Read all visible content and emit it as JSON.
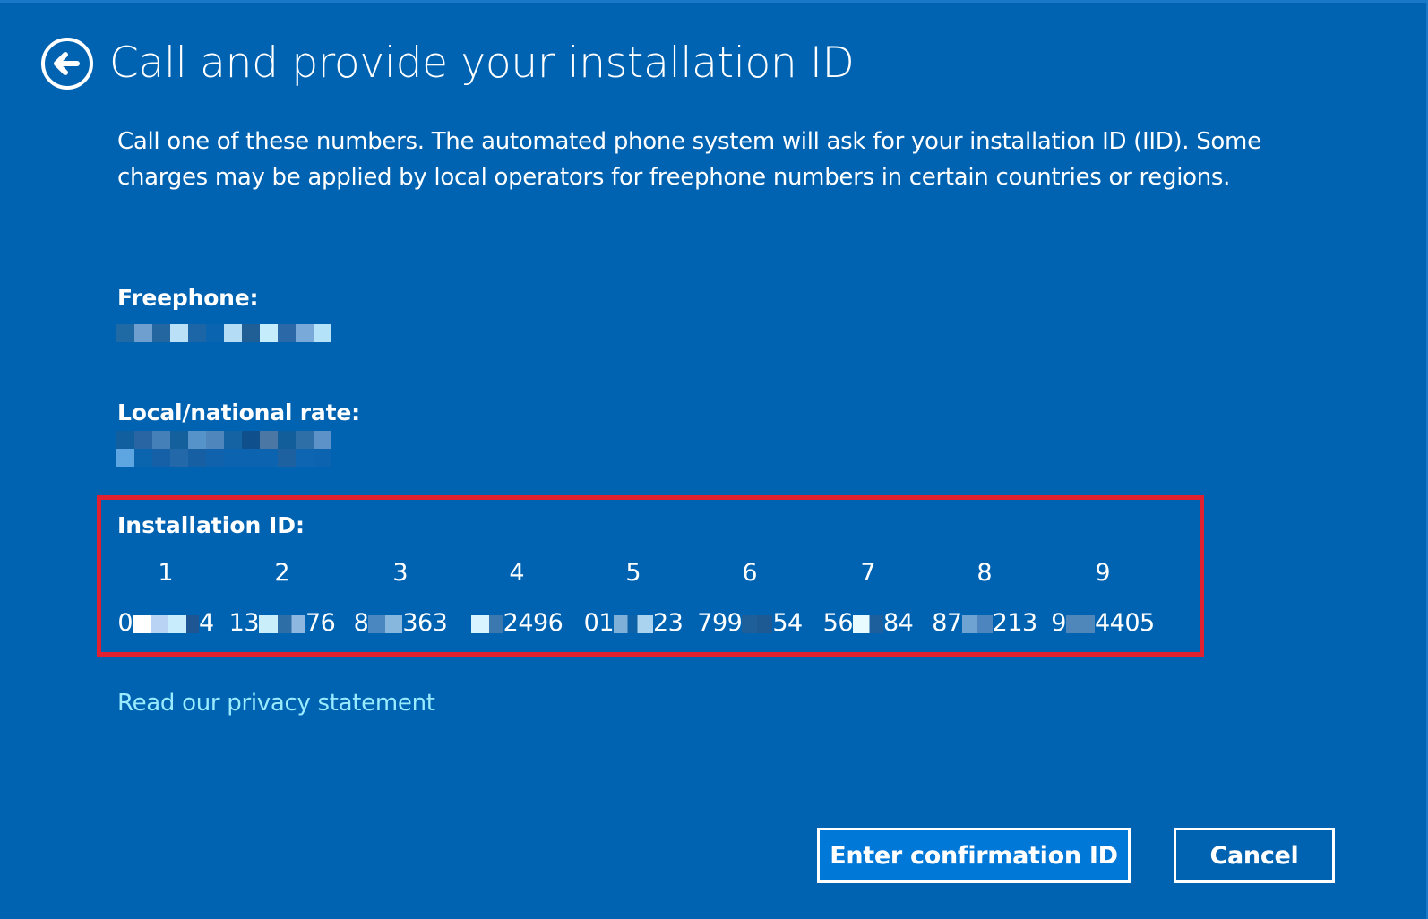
{
  "header": {
    "back_icon": "back-arrow-circle-icon",
    "title": "Call and provide your installation ID"
  },
  "description": "Call one of these numbers. The automated phone system will ask for your installation ID (IID). Some charges may be applied by local operators for freephone numbers in certain countries or regions.",
  "freephone": {
    "label": "Freephone:",
    "value_redacted": true
  },
  "local_rate": {
    "label": "Local/national rate:",
    "value_redacted": true
  },
  "installation_id": {
    "label": "Installation ID:",
    "highlight_color": "#e1212f",
    "groups": [
      {
        "index": "1",
        "visible_prefix": "0",
        "visible_suffix": "4"
      },
      {
        "index": "2",
        "visible_prefix": "13",
        "visible_suffix": "76"
      },
      {
        "index": "3",
        "visible_prefix": "8",
        "visible_suffix": "363"
      },
      {
        "index": "4",
        "visible_prefix": "",
        "visible_suffix": "2496"
      },
      {
        "index": "5",
        "visible_prefix": "01",
        "visible_suffix": "23"
      },
      {
        "index": "6",
        "visible_prefix": "799",
        "visible_suffix": "54"
      },
      {
        "index": "7",
        "visible_prefix": "56",
        "visible_suffix": "84"
      },
      {
        "index": "8",
        "visible_prefix": "87",
        "visible_suffix": "213"
      },
      {
        "index": "9",
        "visible_prefix": "9",
        "visible_suffix": "4405"
      }
    ]
  },
  "privacy_link": "Read our privacy statement",
  "buttons": {
    "primary": "Enter confirmation ID",
    "secondary": "Cancel"
  },
  "colors": {
    "background": "#0063b1",
    "primary_button": "#0078d7",
    "link": "#99ebff"
  }
}
